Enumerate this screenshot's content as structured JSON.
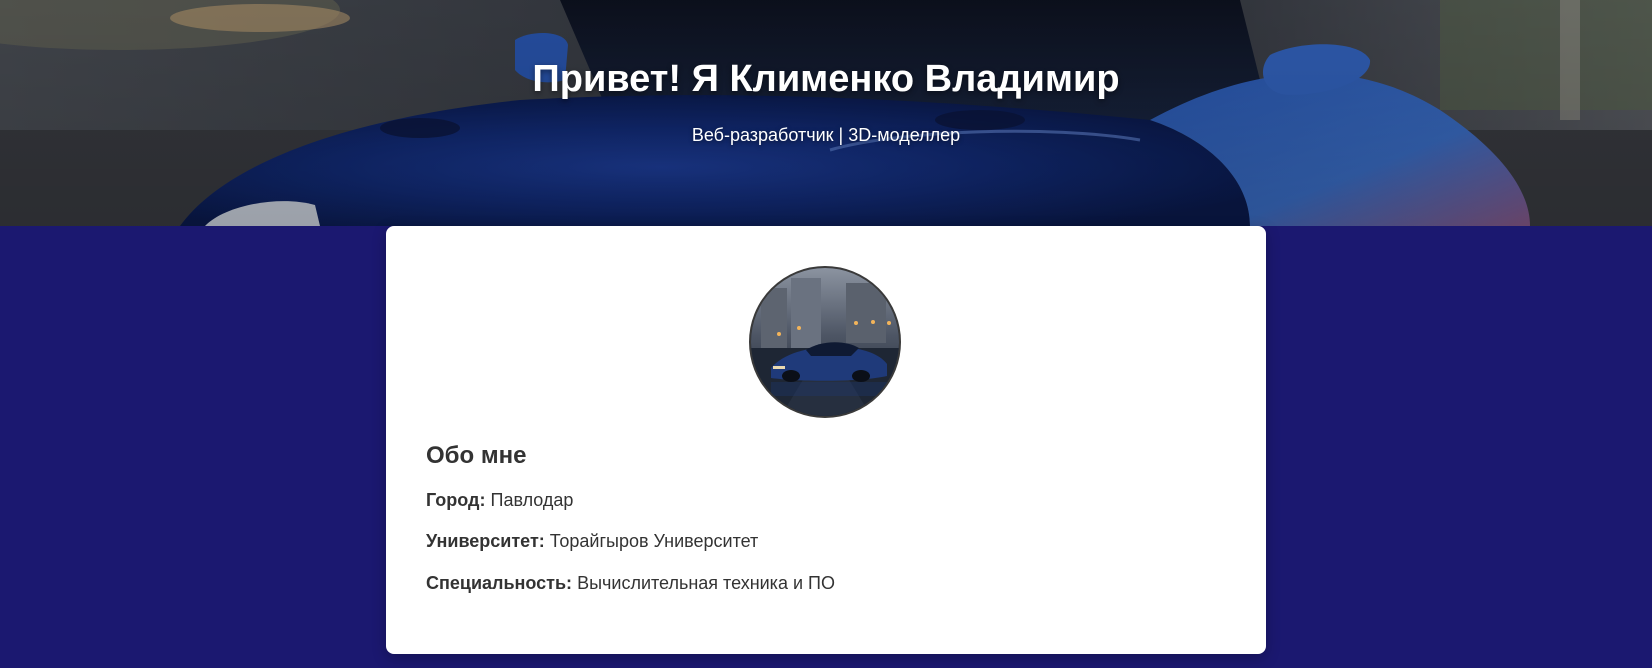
{
  "hero": {
    "title": "Привет! Я Клименко Владимир",
    "subtitle": "Веб-разработчик | 3D-моделлер",
    "background_image": "blue-sports-car-photo"
  },
  "profile": {
    "avatar_image": "car-on-wet-city-street-photo",
    "section_title": "Обо мне",
    "details": [
      {
        "label": "Город:",
        "value": "Павлодар"
      },
      {
        "label": "Университет:",
        "value": "Торайгыров Университет"
      },
      {
        "label": "Специальность:",
        "value": "Вычислительная техника и ПО"
      }
    ]
  },
  "colors": {
    "page_background": "#1b1870",
    "card_background": "#ffffff",
    "text": "#333333",
    "hero_text": "#ffffff"
  }
}
